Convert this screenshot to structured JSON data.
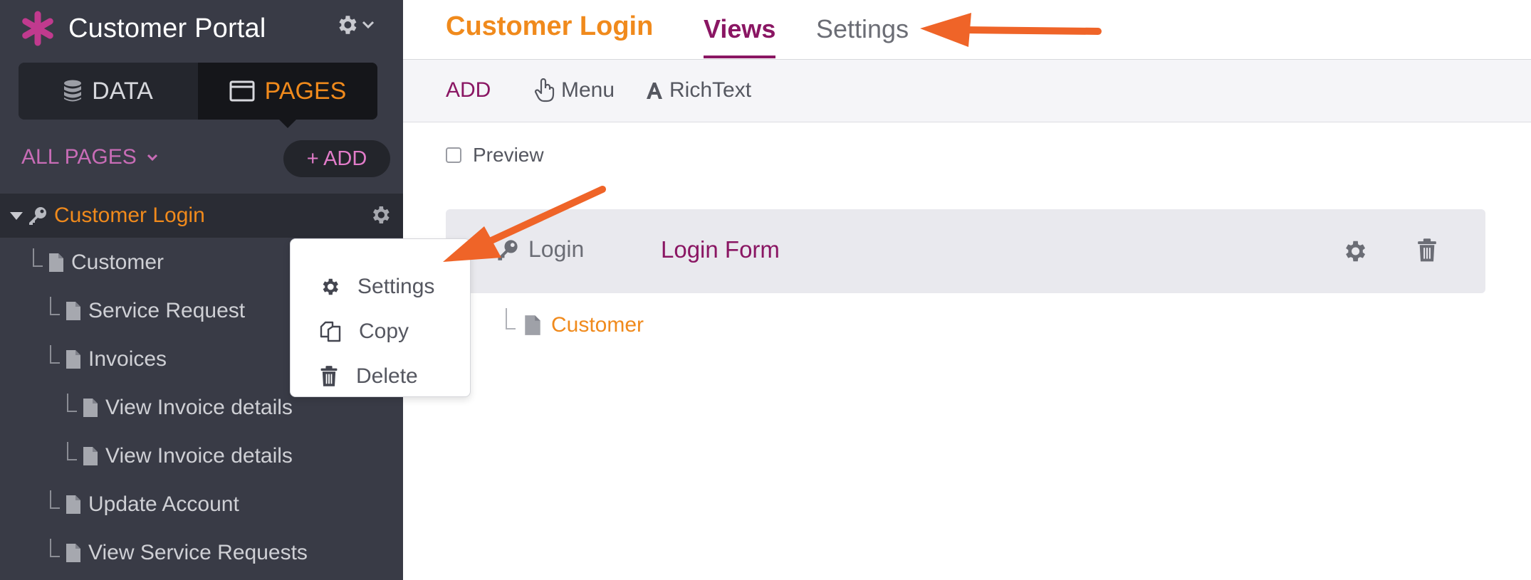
{
  "app": {
    "title": "Customer Portal"
  },
  "colors": {
    "accent_orange": "#f08a1c",
    "accent_purple": "#8a1663",
    "sidebar_bg": "#393b46",
    "arrow": "#ef6428"
  },
  "sidebar": {
    "segments": [
      {
        "label": "DATA",
        "icon": "database-icon"
      },
      {
        "label": "PAGES",
        "icon": "window-icon",
        "active": true
      }
    ],
    "all_pages_label": "ALL PAGES",
    "add_label": "+ ADD",
    "tree": [
      {
        "label": "Customer Login",
        "icon": "key-icon",
        "selected": true
      },
      {
        "label": "Customer",
        "icon": "file-icon"
      },
      {
        "label": "Service Request",
        "icon": "file-icon"
      },
      {
        "label": "Invoices",
        "icon": "file-icon"
      },
      {
        "label": "View Invoice details",
        "icon": "file-icon"
      },
      {
        "label": "View Invoice details",
        "icon": "file-icon"
      },
      {
        "label": "Update Account",
        "icon": "file-icon"
      },
      {
        "label": "View Service Requests",
        "icon": "file-icon"
      }
    ]
  },
  "context_menu": {
    "items": [
      {
        "label": "Settings",
        "icon": "gear-icon"
      },
      {
        "label": "Copy",
        "icon": "copy-icon"
      },
      {
        "label": "Delete",
        "icon": "trash-icon"
      }
    ]
  },
  "main": {
    "page_title": "Customer Login",
    "tabs": [
      {
        "label": "Views",
        "active": true
      },
      {
        "label": "Settings"
      }
    ],
    "toolbar": {
      "add_label": "ADD",
      "menu_label": "Menu",
      "richtext_label": "RichText"
    },
    "preview_label": "Preview",
    "view": {
      "type_label": "Login",
      "name": "Login Form"
    },
    "child": {
      "label": "Customer"
    }
  }
}
